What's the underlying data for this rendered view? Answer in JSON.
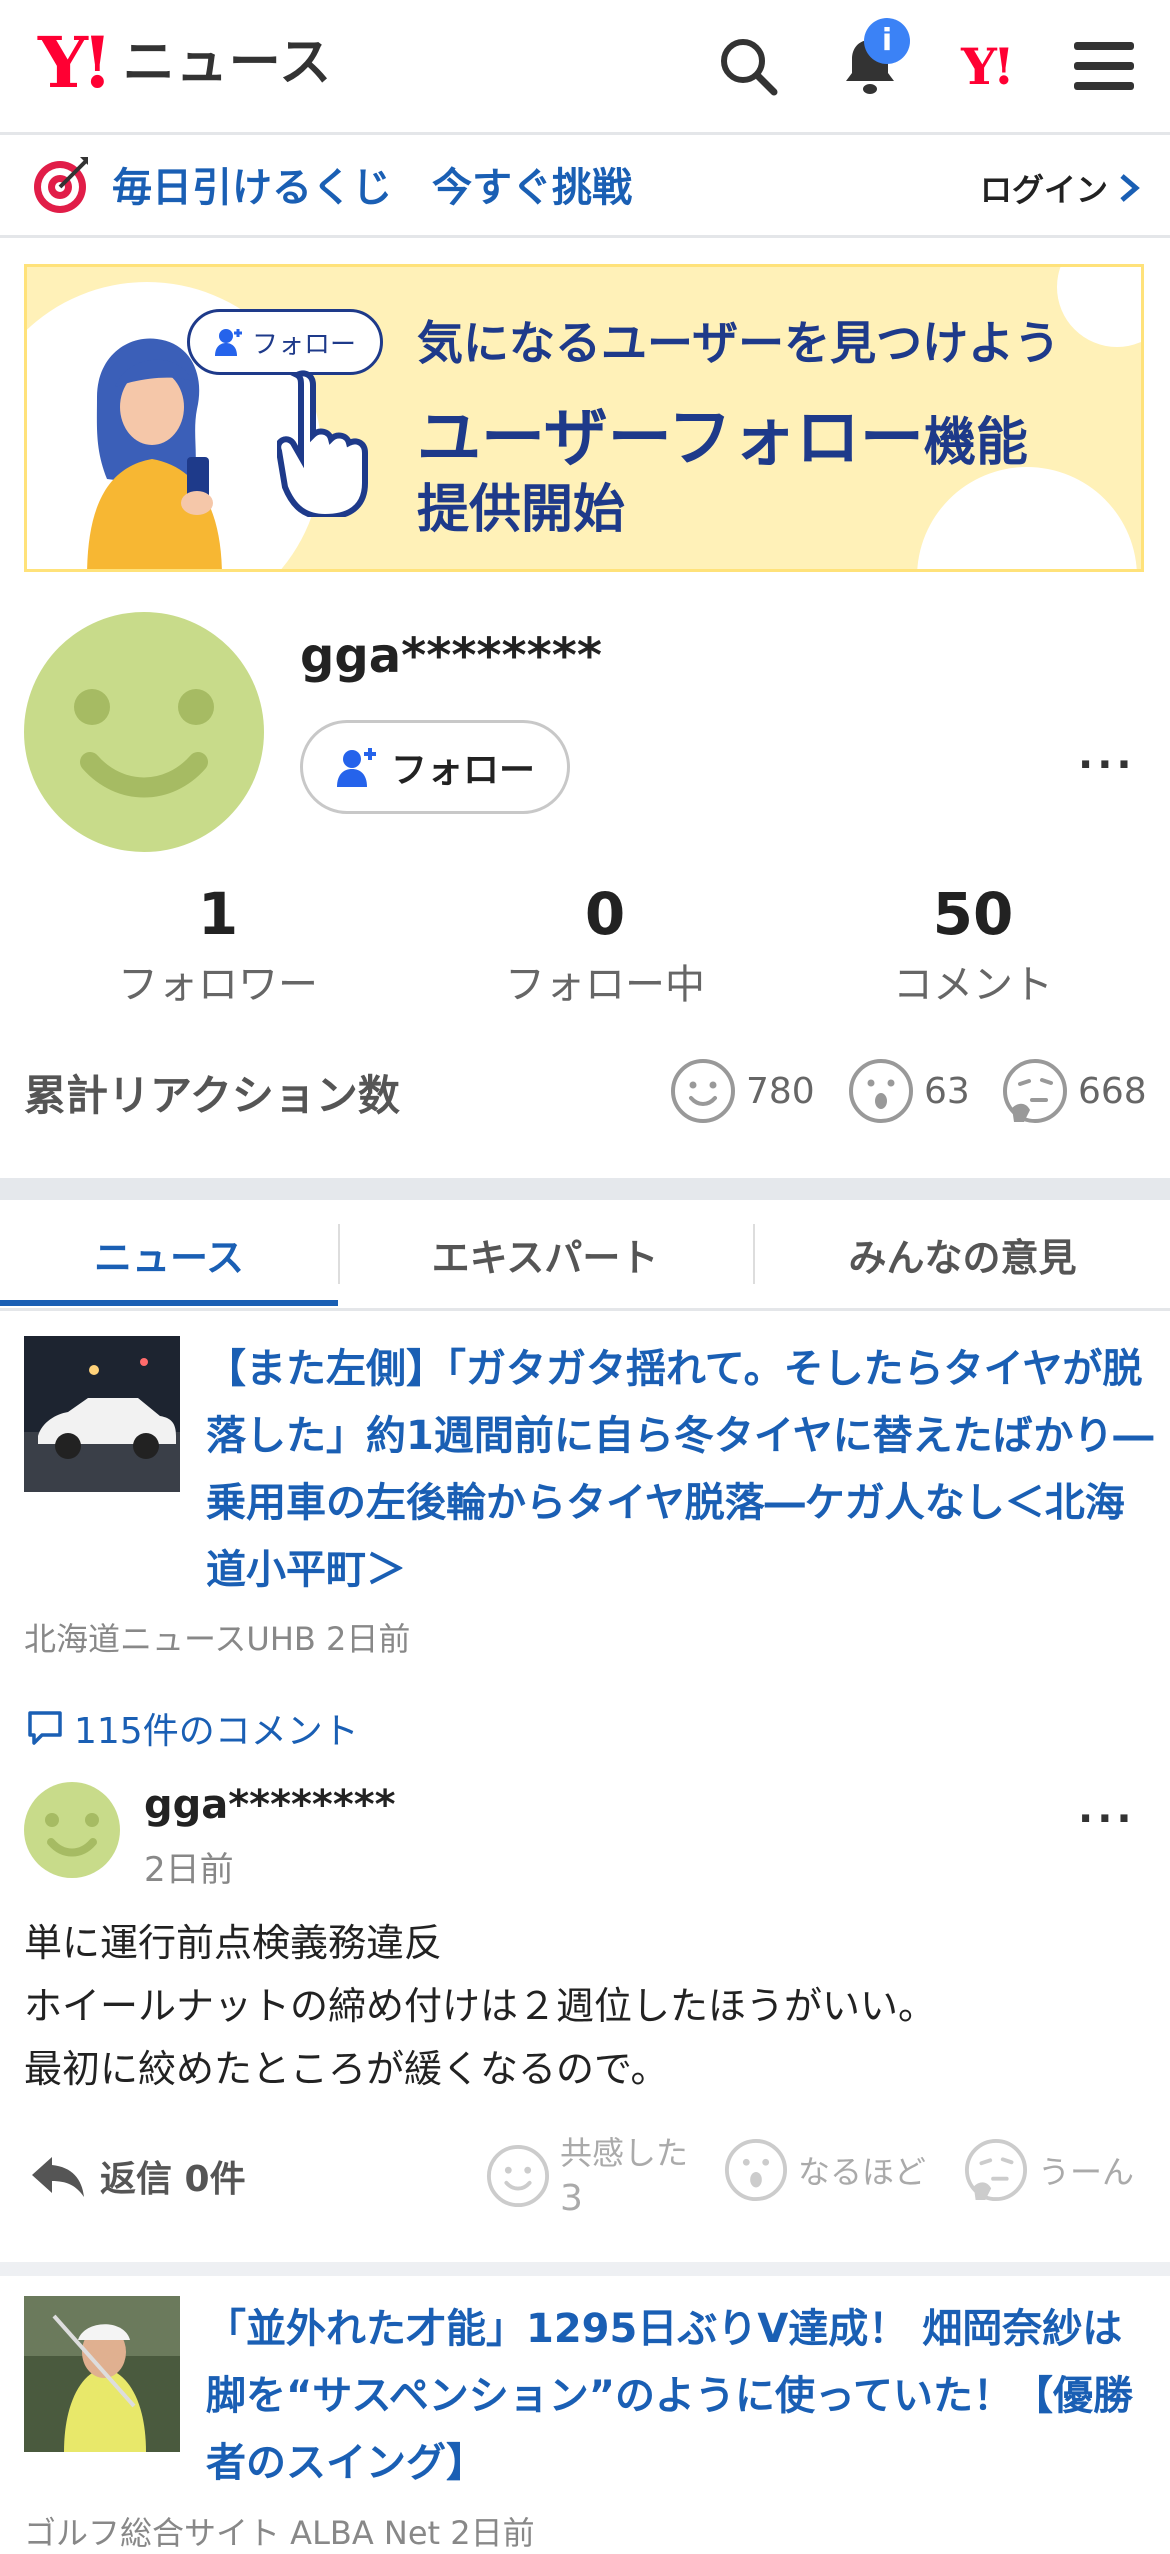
{
  "header": {
    "logo_mark": "Y!",
    "logo_text": "ニュース",
    "notification_badge": "i",
    "yahoo_mark": "Y!"
  },
  "lottery": {
    "text": "毎日引けるくじ　今すぐ挑戦",
    "login": "ログイン"
  },
  "banner": {
    "pill": "フォロー",
    "line1": "気になるユーザーを見つけよう",
    "line2_main": "ユーザーフォロー",
    "line2_small": "機能",
    "line3": "提供開始"
  },
  "profile": {
    "username": "gga********",
    "follow_label": "フォロー",
    "more": "···",
    "stats": [
      {
        "value": "1",
        "label": "フォロワー"
      },
      {
        "value": "0",
        "label": "フォロー中"
      },
      {
        "value": "50",
        "label": "コメント"
      }
    ],
    "reactions_title": "累計リアクション数",
    "reactions": [
      {
        "icon": "smile-icon",
        "count": "780"
      },
      {
        "icon": "surprised-icon",
        "count": "63"
      },
      {
        "icon": "hmm-icon",
        "count": "668"
      }
    ]
  },
  "tabs": [
    "ニュース",
    "エキスパート",
    "みんなの意見"
  ],
  "article1": {
    "title": "【また左側】「ガタガタ揺れて。そしたらタイヤが脱落した」約1週間前に自ら冬タイヤに替えたばかり―乗用車の左後輪からタイヤ脱落―ケガ人なし＜北海道小平町＞",
    "meta": "北海道ニュースUHB 2日前",
    "comment_link": "115件のコメント"
  },
  "comment": {
    "user": "gga********",
    "time": "2日前",
    "lines": [
      "単に運行前点検義務違反",
      "ホイールナットの締め付けは２週位したほうがいい。",
      "最初に絞めたところが緩くなるので。"
    ],
    "reply_label": "返信 0件",
    "reactions": [
      {
        "label": "共感した",
        "count": "3"
      },
      {
        "label": "なるほど",
        "count": ""
      },
      {
        "label": "うーん",
        "count": ""
      }
    ]
  },
  "article2": {
    "title": "「並外れた才能」1295日ぶりV達成！ 畑岡奈紗は脚を“サスペンション”のように使っていた！【優勝者のスイング】",
    "meta": "ゴルフ総合サイト ALBA Net 2日前"
  },
  "colors": {
    "accent": "#1a5fb4",
    "brand": "#ff0033",
    "avatar": "#c8db8a",
    "banner_bg": "#fff1b8"
  }
}
